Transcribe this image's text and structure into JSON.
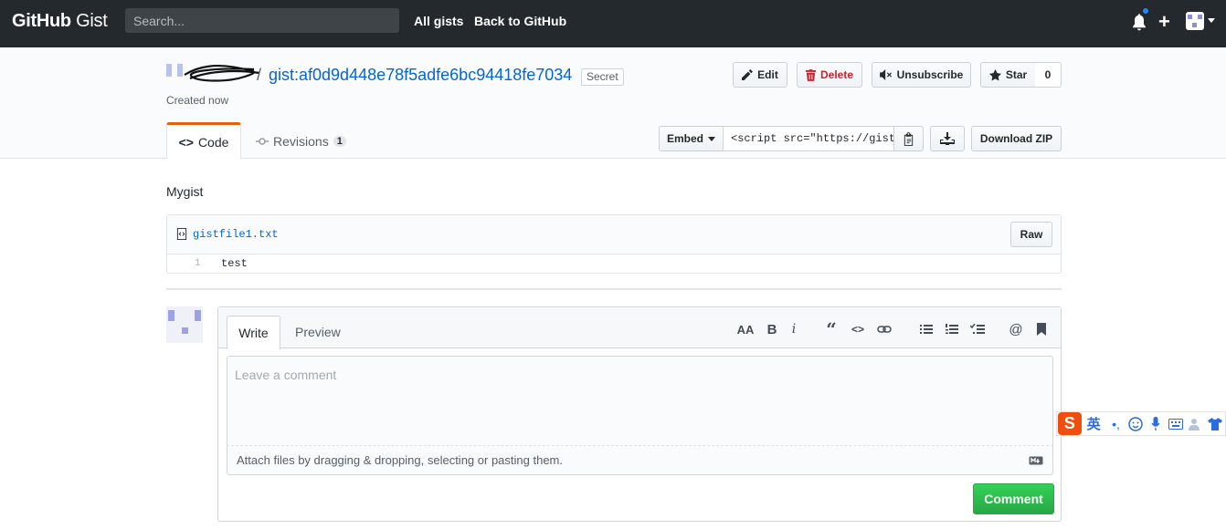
{
  "header": {
    "logo_bold": "GitHub",
    "logo_light": "Gist",
    "search_placeholder": "Search...",
    "nav": [
      "All gists",
      "Back to GitHub"
    ]
  },
  "gist": {
    "owner": "",
    "separator": "/",
    "name": "gist:af0d9d448e78f5adfe6bc94418fe7034",
    "visibility": "Secret",
    "created": "Created now"
  },
  "actions": {
    "edit": "Edit",
    "delete": "Delete",
    "unsubscribe": "Unsubscribe",
    "star": "Star",
    "star_count": "0"
  },
  "tabs": {
    "code": "Code",
    "revisions": "Revisions",
    "revisions_count": "1"
  },
  "embed": {
    "label": "Embed",
    "value": "<script src=\"https://gist.",
    "download_zip": "Download ZIP"
  },
  "description": "Mygist",
  "file": {
    "name": "gistfile1.txt",
    "raw": "Raw",
    "lines": [
      {
        "number": "1",
        "text": "test"
      }
    ]
  },
  "comment": {
    "write_tab": "Write",
    "preview_tab": "Preview",
    "placeholder": "Leave a comment",
    "attach_text": "Attach files by dragging & dropping, selecting or pasting them.",
    "submit": "Comment"
  },
  "ime": {
    "brand": "S",
    "mode": "英",
    "punct": "•,"
  },
  "colors": {
    "header_bg": "#24292e",
    "link": "#0366d6",
    "accent_tab": "#e36209",
    "danger": "#cb2431",
    "primary": "#28a745"
  }
}
